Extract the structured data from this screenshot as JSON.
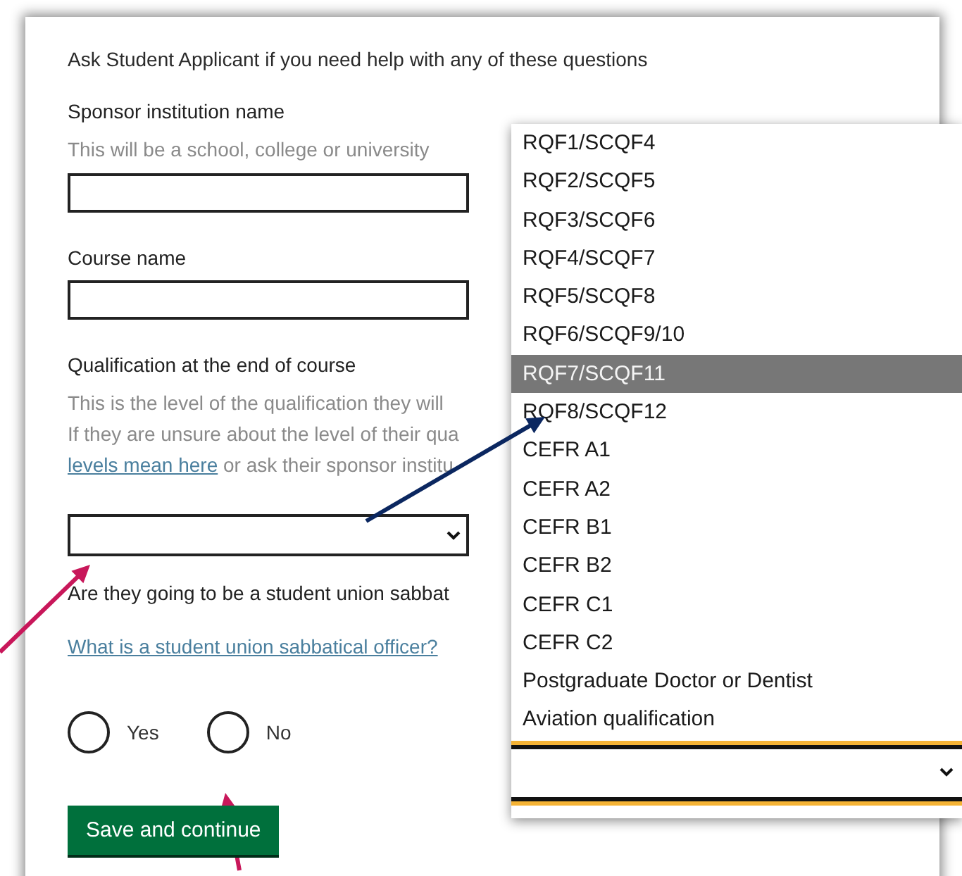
{
  "form": {
    "intro": "Ask Student Applicant if you need help with any of these questions",
    "sponsor": {
      "label": "Sponsor institution name",
      "hint": "This will be a school, college or university"
    },
    "course": {
      "label": "Course name"
    },
    "qualification": {
      "label": "Qualification at the end of course",
      "hint_lines": [
        "This is the level of the qualification they will",
        "If they are unsure about the level of their qua"
      ],
      "link": "levels mean here",
      "link_tail": " or ask their sponsor institu"
    },
    "sabbatical": {
      "question": "Are they going to be a student union sabbat",
      "link": "What is a student union sabbatical officer?",
      "options": [
        {
          "label": "Yes",
          "selected": false
        },
        {
          "label": "No",
          "selected": false
        }
      ]
    },
    "submit": "Save and continue"
  },
  "dropdown": {
    "options": [
      {
        "label": "RQF1/SCQF4",
        "selected": false
      },
      {
        "label": "RQF2/SCQF5",
        "selected": false
      },
      {
        "label": "RQF3/SCQF6",
        "selected": false
      },
      {
        "label": "RQF4/SCQF7",
        "selected": false
      },
      {
        "label": "RQF5/SCQF8",
        "selected": false
      },
      {
        "label": "RQF6/SCQF9/10",
        "selected": false
      },
      {
        "label": "RQF7/SCQF11",
        "selected": true
      },
      {
        "label": "RQF8/SCQF12",
        "selected": false
      },
      {
        "label": "CEFR A1",
        "selected": false
      },
      {
        "label": "CEFR A2",
        "selected": false
      },
      {
        "label": "CEFR B1",
        "selected": false
      },
      {
        "label": "CEFR B2",
        "selected": false
      },
      {
        "label": "CEFR C1",
        "selected": false
      },
      {
        "label": "CEFR C2",
        "selected": false
      },
      {
        "label": "Postgraduate Doctor or Dentist",
        "selected": false
      },
      {
        "label": "Aviation qualification",
        "selected": false
      }
    ]
  }
}
